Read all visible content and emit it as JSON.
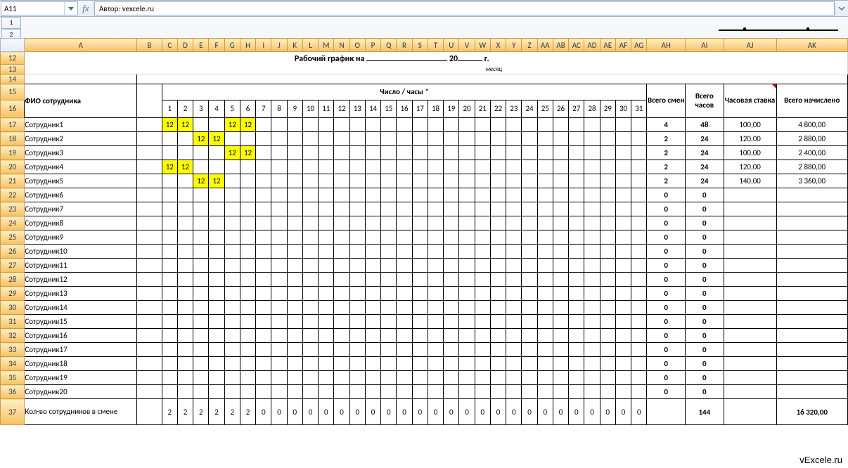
{
  "formula_bar": {
    "cell_ref": "A11",
    "fx_label": "fx",
    "formula": "Автор: vexcele.ru"
  },
  "outline": {
    "levels": [
      "1",
      "2"
    ]
  },
  "col_headers": [
    "A",
    "B",
    "C",
    "D",
    "E",
    "F",
    "G",
    "H",
    "I",
    "J",
    "K",
    "L",
    "M",
    "N",
    "O",
    "P",
    "Q",
    "R",
    "S",
    "T",
    "U",
    "V",
    "W",
    "X",
    "Y",
    "Z",
    "AA",
    "AB",
    "AC",
    "AD",
    "AE",
    "AF",
    "AG",
    "AH",
    "AI",
    "AJ",
    "AK"
  ],
  "row_headers_upper": [
    "12",
    "13",
    "14"
  ],
  "sheet_title": {
    "prefix": "Рабочий график на",
    "year_prefix": "20",
    "year_suffix": "г.",
    "month_hint": "месяц"
  },
  "headers": {
    "fio": "ФИО сотрудника",
    "days_hours": "Число / часы *",
    "total_shifts": "Всего смен",
    "total_hours": "Всего часов",
    "hour_rate": "Часовая ставка",
    "total_pay": "Всего начислено"
  },
  "day_numbers": [
    "1",
    "2",
    "3",
    "4",
    "5",
    "6",
    "7",
    "8",
    "9",
    "10",
    "11",
    "12",
    "13",
    "14",
    "15",
    "16",
    "17",
    "18",
    "19",
    "20",
    "21",
    "22",
    "23",
    "24",
    "25",
    "26",
    "27",
    "28",
    "29",
    "30",
    "31"
  ],
  "rows": [
    {
      "rn": "17",
      "name": "Сотрудник1",
      "days": [
        "12",
        "12",
        "",
        "",
        "12",
        "12",
        "",
        "",
        "",
        "",
        "",
        "",
        "",
        "",
        "",
        "",
        "",
        "",
        "",
        "",
        "",
        "",
        "",
        "",
        "",
        "",
        "",
        "",
        "",
        "",
        ""
      ],
      "shifts": "4",
      "hours": "48",
      "rate": "100,00",
      "pay": "4 800,00"
    },
    {
      "rn": "18",
      "name": "Сотрудник2",
      "days": [
        "",
        "",
        "12",
        "12",
        "",
        "",
        "",
        "",
        "",
        "",
        "",
        "",
        "",
        "",
        "",
        "",
        "",
        "",
        "",
        "",
        "",
        "",
        "",
        "",
        "",
        "",
        "",
        "",
        "",
        "",
        ""
      ],
      "shifts": "2",
      "hours": "24",
      "rate": "120,00",
      "pay": "2 880,00"
    },
    {
      "rn": "19",
      "name": "Сотрудник3",
      "days": [
        "",
        "",
        "",
        "",
        "12",
        "12",
        "",
        "",
        "",
        "",
        "",
        "",
        "",
        "",
        "",
        "",
        "",
        "",
        "",
        "",
        "",
        "",
        "",
        "",
        "",
        "",
        "",
        "",
        "",
        "",
        ""
      ],
      "shifts": "2",
      "hours": "24",
      "rate": "100,00",
      "pay": "2 400,00"
    },
    {
      "rn": "20",
      "name": "Сотрудник4",
      "days": [
        "12",
        "12",
        "",
        "",
        "",
        "",
        "",
        "",
        "",
        "",
        "",
        "",
        "",
        "",
        "",
        "",
        "",
        "",
        "",
        "",
        "",
        "",
        "",
        "",
        "",
        "",
        "",
        "",
        "",
        "",
        ""
      ],
      "shifts": "2",
      "hours": "24",
      "rate": "120,00",
      "pay": "2 880,00"
    },
    {
      "rn": "21",
      "name": "Сотрудник5",
      "days": [
        "",
        "",
        "12",
        "12",
        "",
        "",
        "",
        "",
        "",
        "",
        "",
        "",
        "",
        "",
        "",
        "",
        "",
        "",
        "",
        "",
        "",
        "",
        "",
        "",
        "",
        "",
        "",
        "",
        "",
        "",
        ""
      ],
      "shifts": "2",
      "hours": "24",
      "rate": "140,00",
      "pay": "3 360,00"
    },
    {
      "rn": "22",
      "name": "Сотрудник6",
      "days": [
        "",
        "",
        "",
        "",
        "",
        "",
        "",
        "",
        "",
        "",
        "",
        "",
        "",
        "",
        "",
        "",
        "",
        "",
        "",
        "",
        "",
        "",
        "",
        "",
        "",
        "",
        "",
        "",
        "",
        "",
        ""
      ],
      "shifts": "0",
      "hours": "0",
      "rate": "",
      "pay": ""
    },
    {
      "rn": "23",
      "name": "Сотрудник7",
      "days": [
        "",
        "",
        "",
        "",
        "",
        "",
        "",
        "",
        "",
        "",
        "",
        "",
        "",
        "",
        "",
        "",
        "",
        "",
        "",
        "",
        "",
        "",
        "",
        "",
        "",
        "",
        "",
        "",
        "",
        "",
        ""
      ],
      "shifts": "0",
      "hours": "0",
      "rate": "",
      "pay": ""
    },
    {
      "rn": "24",
      "name": "Сотрудник8",
      "days": [
        "",
        "",
        "",
        "",
        "",
        "",
        "",
        "",
        "",
        "",
        "",
        "",
        "",
        "",
        "",
        "",
        "",
        "",
        "",
        "",
        "",
        "",
        "",
        "",
        "",
        "",
        "",
        "",
        "",
        "",
        ""
      ],
      "shifts": "0",
      "hours": "0",
      "rate": "",
      "pay": ""
    },
    {
      "rn": "25",
      "name": "Сотрудник9",
      "days": [
        "",
        "",
        "",
        "",
        "",
        "",
        "",
        "",
        "",
        "",
        "",
        "",
        "",
        "",
        "",
        "",
        "",
        "",
        "",
        "",
        "",
        "",
        "",
        "",
        "",
        "",
        "",
        "",
        "",
        "",
        ""
      ],
      "shifts": "0",
      "hours": "0",
      "rate": "",
      "pay": ""
    },
    {
      "rn": "26",
      "name": "Сотрудник10",
      "days": [
        "",
        "",
        "",
        "",
        "",
        "",
        "",
        "",
        "",
        "",
        "",
        "",
        "",
        "",
        "",
        "",
        "",
        "",
        "",
        "",
        "",
        "",
        "",
        "",
        "",
        "",
        "",
        "",
        "",
        "",
        ""
      ],
      "shifts": "0",
      "hours": "0",
      "rate": "",
      "pay": ""
    },
    {
      "rn": "27",
      "name": "Сотрудник11",
      "days": [
        "",
        "",
        "",
        "",
        "",
        "",
        "",
        "",
        "",
        "",
        "",
        "",
        "",
        "",
        "",
        "",
        "",
        "",
        "",
        "",
        "",
        "",
        "",
        "",
        "",
        "",
        "",
        "",
        "",
        "",
        ""
      ],
      "shifts": "0",
      "hours": "0",
      "rate": "",
      "pay": ""
    },
    {
      "rn": "28",
      "name": "Сотрудник12",
      "days": [
        "",
        "",
        "",
        "",
        "",
        "",
        "",
        "",
        "",
        "",
        "",
        "",
        "",
        "",
        "",
        "",
        "",
        "",
        "",
        "",
        "",
        "",
        "",
        "",
        "",
        "",
        "",
        "",
        "",
        "",
        ""
      ],
      "shifts": "0",
      "hours": "0",
      "rate": "",
      "pay": ""
    },
    {
      "rn": "29",
      "name": "Сотрудник13",
      "days": [
        "",
        "",
        "",
        "",
        "",
        "",
        "",
        "",
        "",
        "",
        "",
        "",
        "",
        "",
        "",
        "",
        "",
        "",
        "",
        "",
        "",
        "",
        "",
        "",
        "",
        "",
        "",
        "",
        "",
        "",
        ""
      ],
      "shifts": "0",
      "hours": "0",
      "rate": "",
      "pay": ""
    },
    {
      "rn": "30",
      "name": "Сотрудник14",
      "days": [
        "",
        "",
        "",
        "",
        "",
        "",
        "",
        "",
        "",
        "",
        "",
        "",
        "",
        "",
        "",
        "",
        "",
        "",
        "",
        "",
        "",
        "",
        "",
        "",
        "",
        "",
        "",
        "",
        "",
        "",
        ""
      ],
      "shifts": "0",
      "hours": "0",
      "rate": "",
      "pay": ""
    },
    {
      "rn": "31",
      "name": "Сотрудник15",
      "days": [
        "",
        "",
        "",
        "",
        "",
        "",
        "",
        "",
        "",
        "",
        "",
        "",
        "",
        "",
        "",
        "",
        "",
        "",
        "",
        "",
        "",
        "",
        "",
        "",
        "",
        "",
        "",
        "",
        "",
        "",
        ""
      ],
      "shifts": "0",
      "hours": "0",
      "rate": "",
      "pay": ""
    },
    {
      "rn": "32",
      "name": "Сотрудник16",
      "days": [
        "",
        "",
        "",
        "",
        "",
        "",
        "",
        "",
        "",
        "",
        "",
        "",
        "",
        "",
        "",
        "",
        "",
        "",
        "",
        "",
        "",
        "",
        "",
        "",
        "",
        "",
        "",
        "",
        "",
        "",
        ""
      ],
      "shifts": "0",
      "hours": "0",
      "rate": "",
      "pay": ""
    },
    {
      "rn": "33",
      "name": "Сотрудник17",
      "days": [
        "",
        "",
        "",
        "",
        "",
        "",
        "",
        "",
        "",
        "",
        "",
        "",
        "",
        "",
        "",
        "",
        "",
        "",
        "",
        "",
        "",
        "",
        "",
        "",
        "",
        "",
        "",
        "",
        "",
        "",
        ""
      ],
      "shifts": "0",
      "hours": "0",
      "rate": "",
      "pay": ""
    },
    {
      "rn": "34",
      "name": "Сотрудник18",
      "days": [
        "",
        "",
        "",
        "",
        "",
        "",
        "",
        "",
        "",
        "",
        "",
        "",
        "",
        "",
        "",
        "",
        "",
        "",
        "",
        "",
        "",
        "",
        "",
        "",
        "",
        "",
        "",
        "",
        "",
        "",
        ""
      ],
      "shifts": "0",
      "hours": "0",
      "rate": "",
      "pay": ""
    },
    {
      "rn": "35",
      "name": "Сотрудник19",
      "days": [
        "",
        "",
        "",
        "",
        "",
        "",
        "",
        "",
        "",
        "",
        "",
        "",
        "",
        "",
        "",
        "",
        "",
        "",
        "",
        "",
        "",
        "",
        "",
        "",
        "",
        "",
        "",
        "",
        "",
        "",
        ""
      ],
      "shifts": "0",
      "hours": "0",
      "rate": "",
      "pay": ""
    },
    {
      "rn": "36",
      "name": "Сотрудник20",
      "days": [
        "",
        "",
        "",
        "",
        "",
        "",
        "",
        "",
        "",
        "",
        "",
        "",
        "",
        "",
        "",
        "",
        "",
        "",
        "",
        "",
        "",
        "",
        "",
        "",
        "",
        "",
        "",
        "",
        "",
        "",
        ""
      ],
      "shifts": "0",
      "hours": "0",
      "rate": "",
      "pay": ""
    }
  ],
  "footer": {
    "rn": "37",
    "label": "Кол-во сотрудников в смене",
    "days": [
      "2",
      "2",
      "2",
      "2",
      "2",
      "2",
      "0",
      "0",
      "0",
      "0",
      "0",
      "0",
      "0",
      "0",
      "0",
      "0",
      "0",
      "0",
      "0",
      "0",
      "0",
      "0",
      "0",
      "0",
      "0",
      "0",
      "0",
      "0",
      "0",
      "0",
      "0"
    ],
    "shifts": "",
    "hours": "144",
    "rate": "",
    "pay": "16 320,00"
  },
  "watermark": "vExcele.ru"
}
